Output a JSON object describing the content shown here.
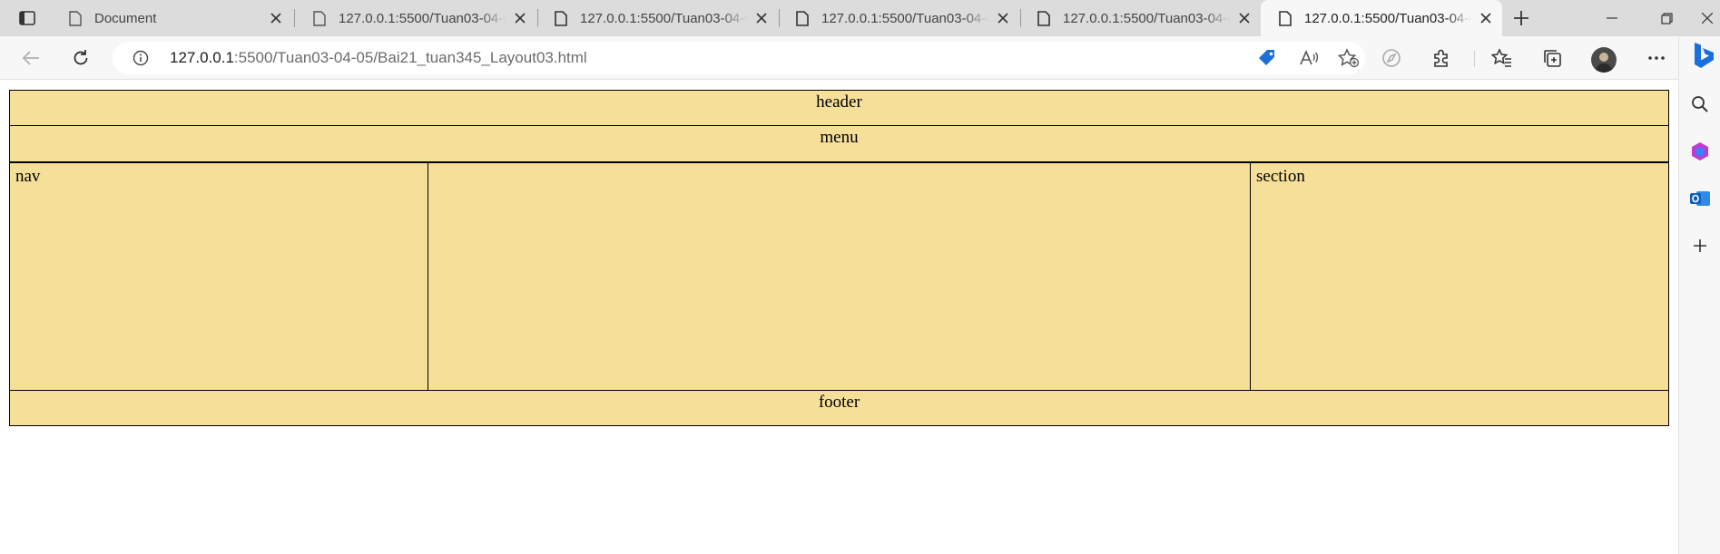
{
  "browser": {
    "tabs": [
      {
        "title": "Document",
        "active": false
      },
      {
        "title": "127.0.0.1:5500/Tuan03-04-05/Bai21_tuan345_Layout03.html",
        "active": false
      },
      {
        "title": "127.0.0.1:5500/Tuan03-04-05/Bai21_tuan345_Layout03.html",
        "active": false
      },
      {
        "title": "127.0.0.1:5500/Tuan03-04-05/Bai21_tuan345_Layout03.html",
        "active": false
      },
      {
        "title": "127.0.0.1:5500/Tuan03-04-05/Bai21_tuan345_Layout03.html",
        "active": false
      },
      {
        "title": "127.0.0.1:5500/Tuan03-04-05/Bai21_tuan345_Layout03.html",
        "active": true
      }
    ],
    "address": {
      "host": "127.0.0.1",
      "rest": ":5500/Tuan03-04-05/Bai21_tuan345_Layout03.html"
    },
    "colors": {
      "tabstrip_bg": "#dcdcdc",
      "toolbar_bg": "#f7f7f7",
      "shopping_tag": "#1e6fd9"
    }
  },
  "page": {
    "header": "header",
    "menu": "menu",
    "nav": "nav",
    "main": "",
    "section": "section",
    "footer": "footer",
    "colors": {
      "box_bg": "#f5df99",
      "border": "#000000"
    }
  }
}
